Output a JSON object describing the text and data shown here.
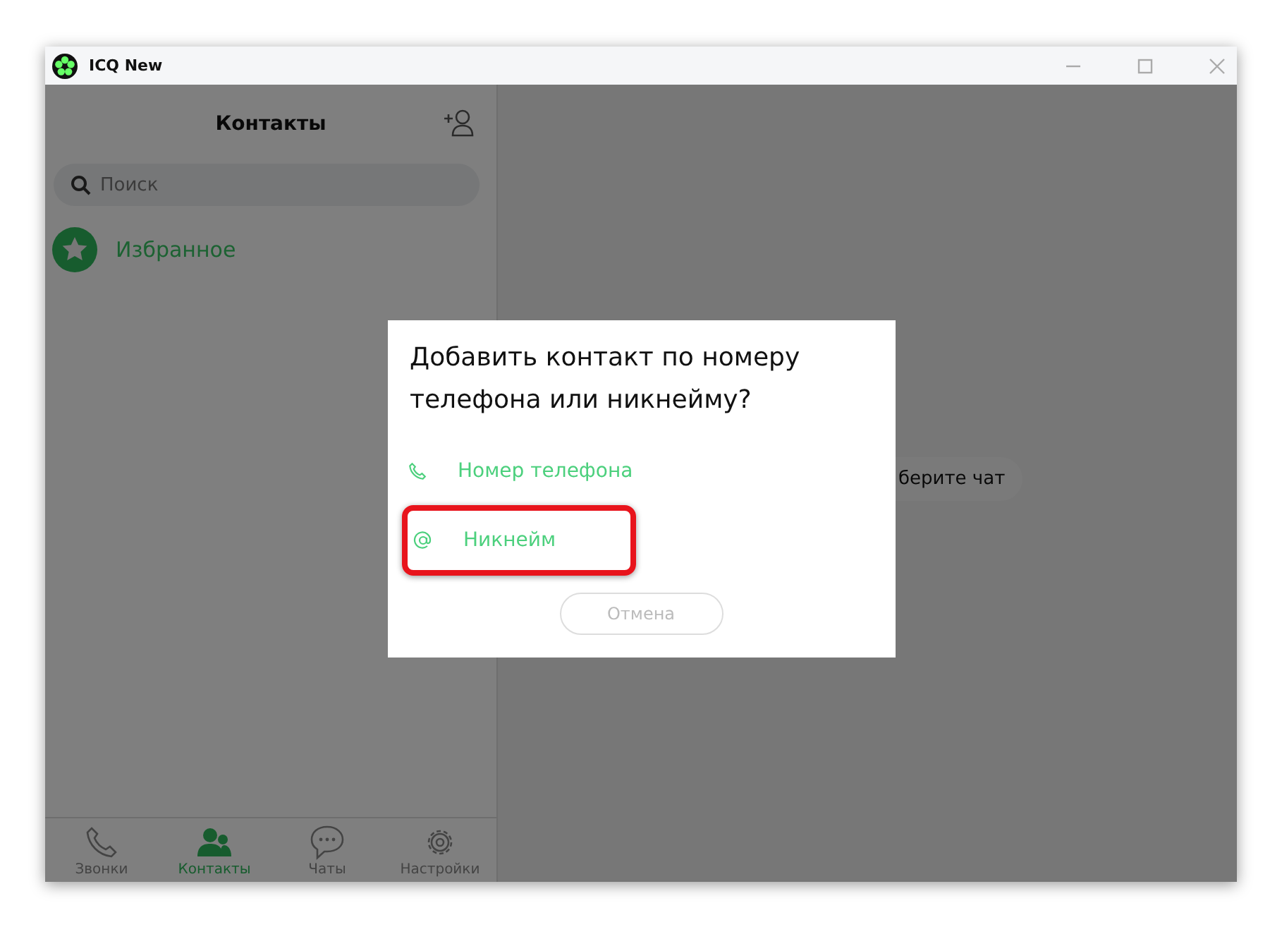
{
  "window": {
    "title": "ICQ New"
  },
  "sidebar": {
    "title": "Контакты",
    "search": {
      "placeholder": "Поиск"
    },
    "items": [
      {
        "label": "Избранное",
        "kind": "favorites"
      }
    ]
  },
  "nav_tabs": [
    {
      "label": "Звонки",
      "kind": "calls",
      "selected": false
    },
    {
      "label": "Контакты",
      "kind": "contacts",
      "selected": true
    },
    {
      "label": "Чаты",
      "kind": "chats",
      "selected": false
    },
    {
      "label": "Настройки",
      "kind": "settings",
      "selected": false
    }
  ],
  "main": {
    "hint": "берите чат"
  },
  "dialog": {
    "title": "Добавить контакт по номеру телефона или никнейму?",
    "options": [
      {
        "label": "Номер телефона",
        "kind": "phone",
        "highlighted": false
      },
      {
        "label": "Никнейм",
        "kind": "nickname",
        "highlighted": true
      }
    ],
    "cancel": "Отмена"
  }
}
